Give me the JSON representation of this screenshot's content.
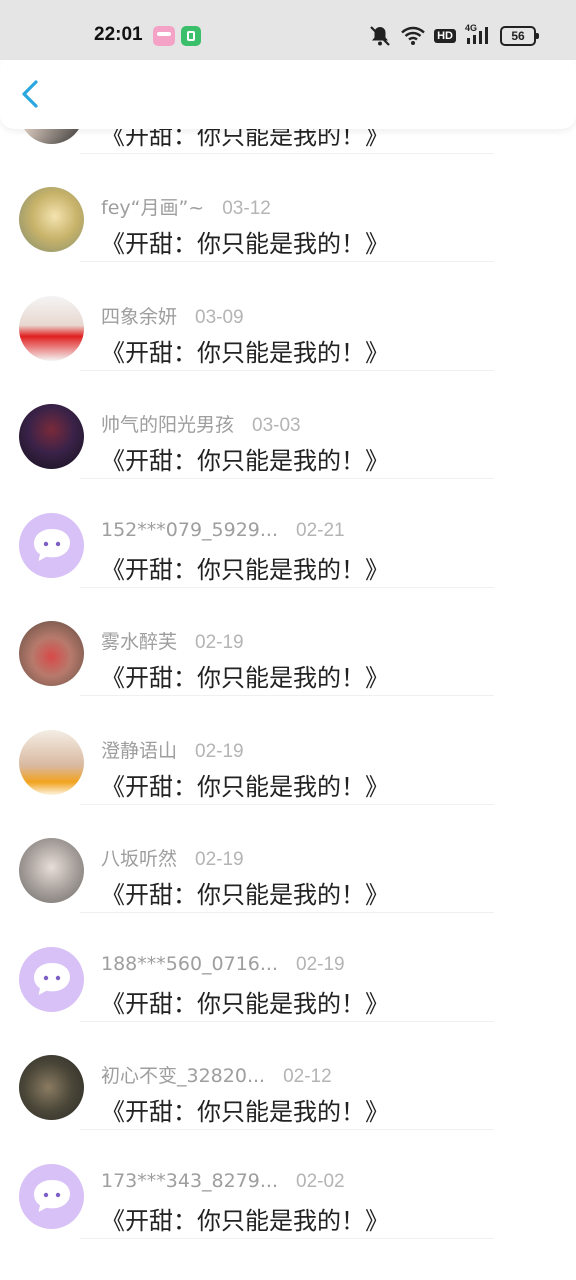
{
  "status_bar": {
    "time": "22:01",
    "hd": "HD",
    "network": "4G",
    "battery": "56",
    "icons": [
      "pink-app-icon",
      "green-app-icon",
      "mute-bell-icon",
      "wifi-icon",
      "hd-icon",
      "signal-icon",
      "battery-icon"
    ]
  },
  "nav": {
    "back_icon": "chevron-left-icon",
    "accent": "#2aa6e0"
  },
  "comments": [
    {
      "name": "",
      "date": "",
      "text": "《开甜：你只能是我的！》",
      "avatar": "photo"
    },
    {
      "name": "fey“月画”~",
      "date": "03-12",
      "text": "《开甜：你只能是我的！》",
      "avatar": "photo"
    },
    {
      "name": "四象余妍",
      "date": "03-09",
      "text": "《开甜：你只能是我的！》",
      "avatar": "photo"
    },
    {
      "name": "帅气的阳光男孩",
      "date": "03-03",
      "text": "《开甜：你只能是我的！》",
      "avatar": "photo"
    },
    {
      "name": "152***079_5929...",
      "date": "02-21",
      "text": "《开甜：你只能是我的！》",
      "avatar": "default-chat-bubble"
    },
    {
      "name": "雾水醉芙",
      "date": "02-19",
      "text": "《开甜：你只能是我的！》",
      "avatar": "photo"
    },
    {
      "name": "澄静语山",
      "date": "02-19",
      "text": "《开甜：你只能是我的！》",
      "avatar": "photo"
    },
    {
      "name": "八坂听然",
      "date": "02-19",
      "text": "《开甜：你只能是我的！》",
      "avatar": "photo"
    },
    {
      "name": "188***560_0716...",
      "date": "02-19",
      "text": "《开甜：你只能是我的！》",
      "avatar": "default-chat-bubble"
    },
    {
      "name": "初心不变_32820...",
      "date": "02-12",
      "text": "《开甜：你只能是我的！》",
      "avatar": "photo"
    },
    {
      "name": "173***343_8279...",
      "date": "02-02",
      "text": "《开甜：你只能是我的！》",
      "avatar": "default-chat-bubble"
    }
  ]
}
